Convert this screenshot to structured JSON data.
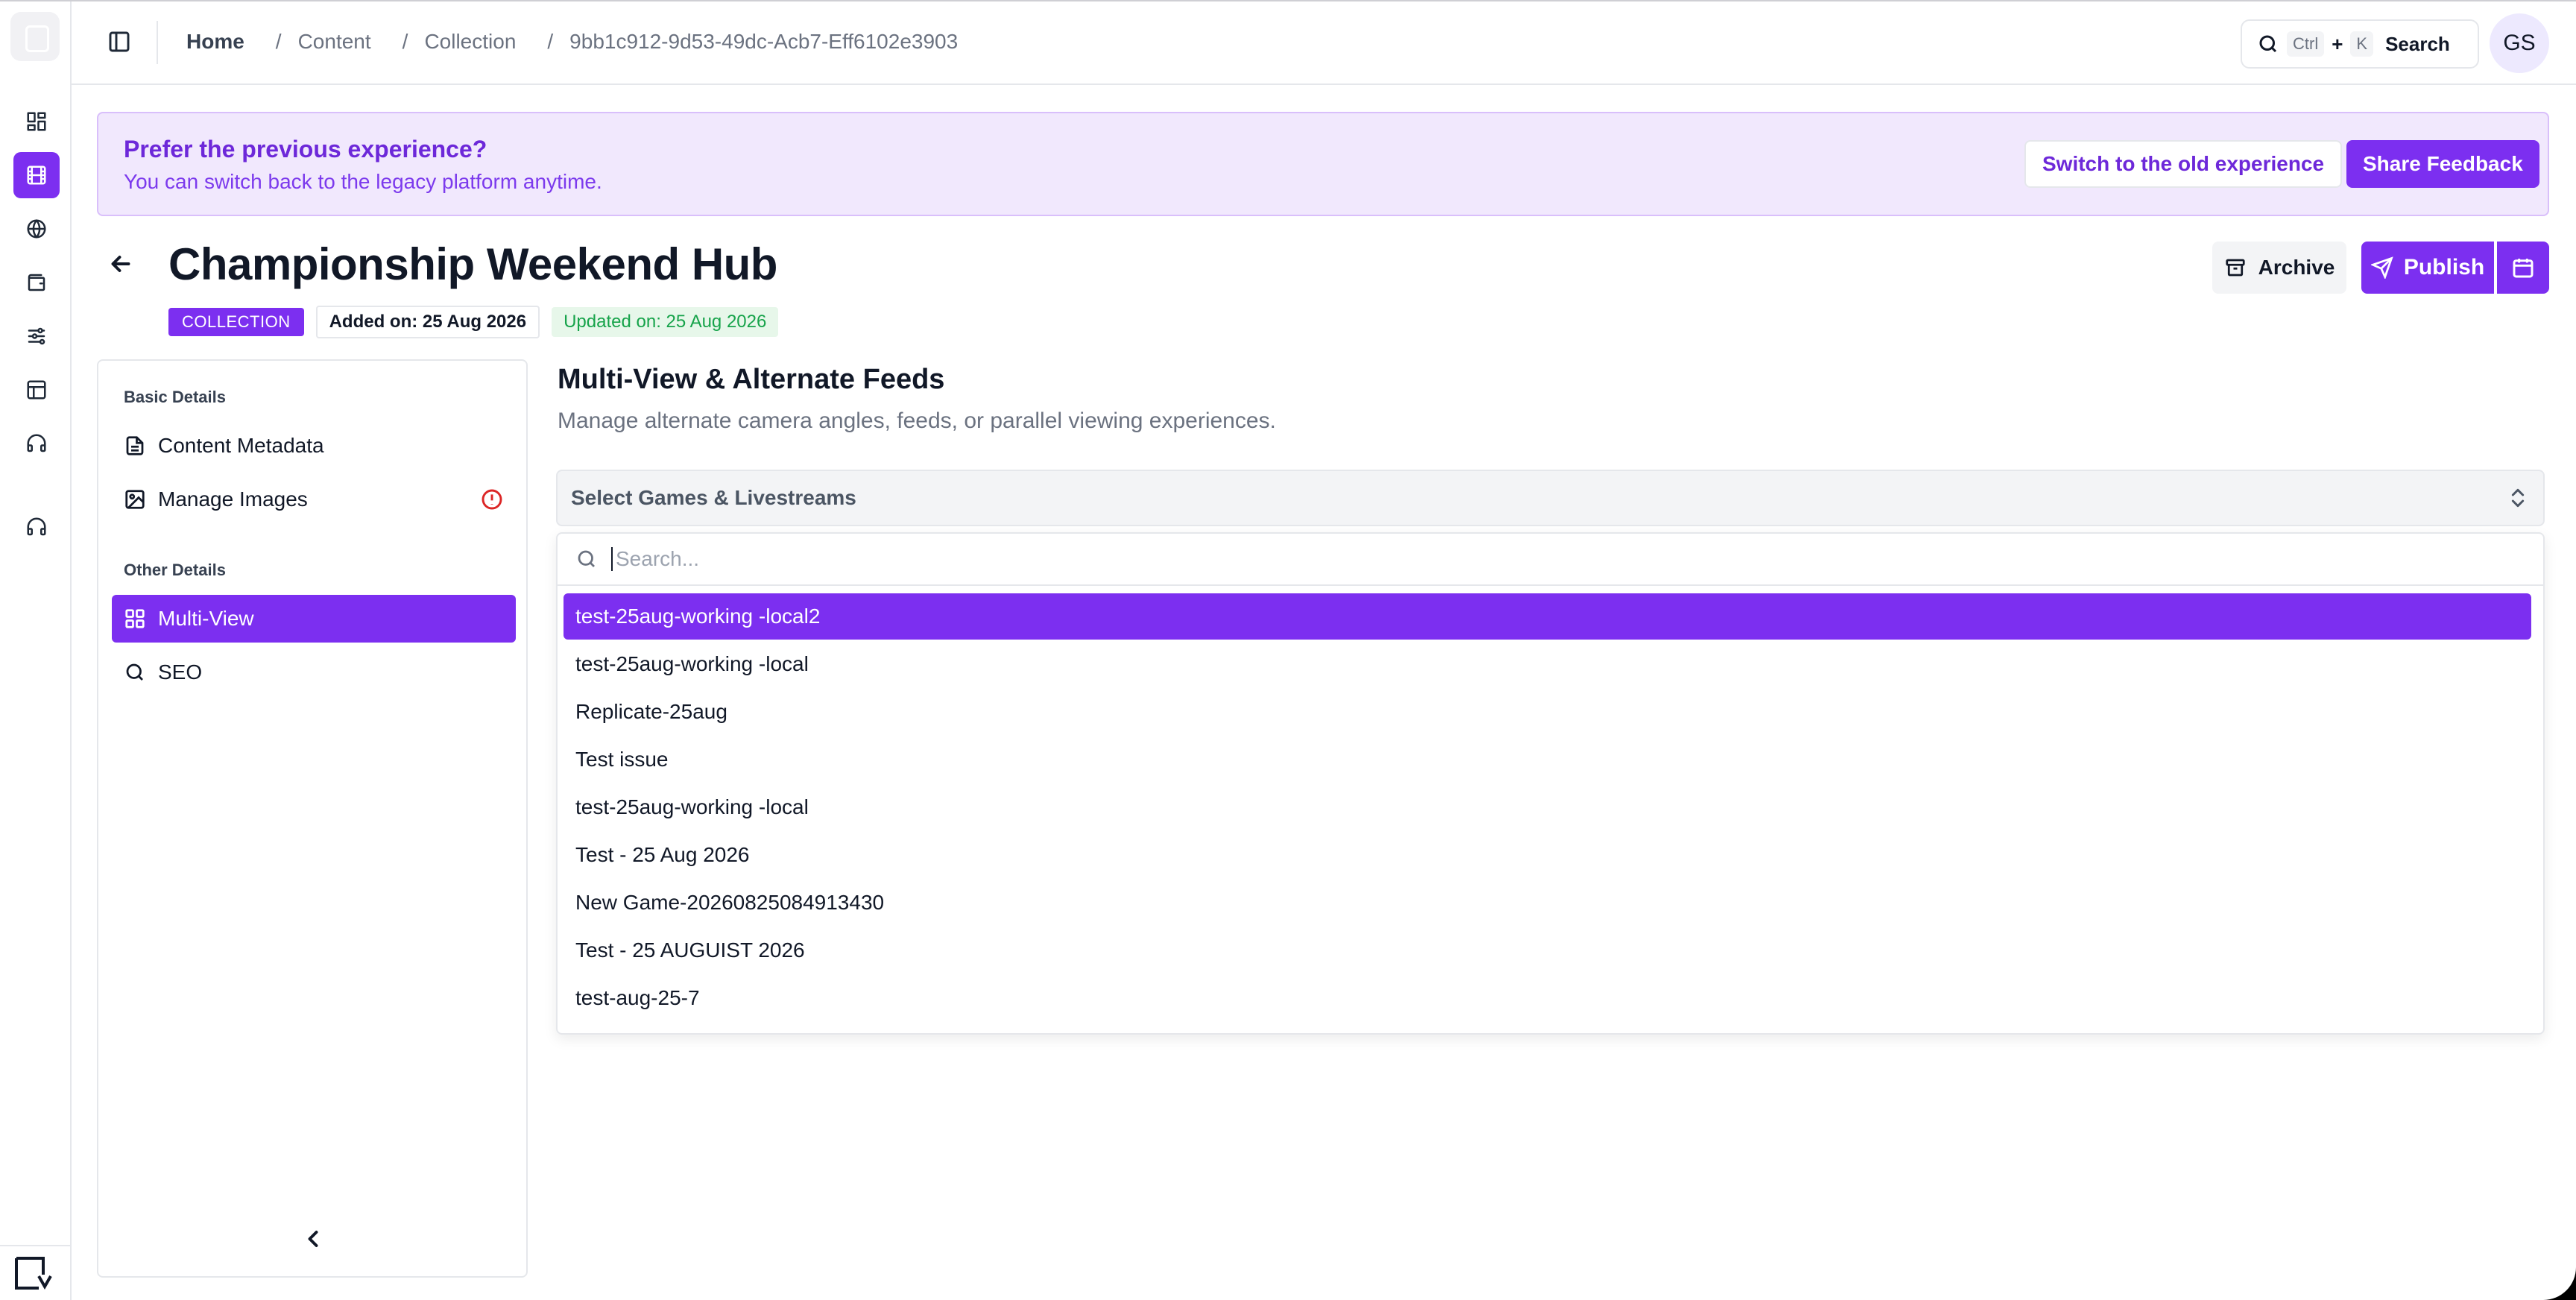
{
  "topbar": {
    "breadcrumb": [
      "Home",
      "Content",
      "Collection",
      "9bb1c912-9d53-49dc-Acb7-Eff6102e3903"
    ],
    "search": {
      "kbd1": "Ctrl",
      "plus": "+",
      "kbd2": "K",
      "label": "Search"
    },
    "avatar_initials": "GS"
  },
  "banner": {
    "title": "Prefer the previous experience?",
    "subtitle": "You can switch back to the legacy platform anytime.",
    "switch_label": "Switch to the old experience",
    "feedback_label": "Share Feedback"
  },
  "page": {
    "title": "Championship Weekend Hub",
    "type_badge": "COLLECTION",
    "added": "Added on: 25 Aug 2026",
    "updated": "Updated on: 25 Aug 2026",
    "archive_label": "Archive",
    "publish_label": "Publish"
  },
  "sidenav": {
    "basic_title": "Basic Details",
    "basic_items": [
      "Content Metadata",
      "Manage Images"
    ],
    "other_title": "Other Details",
    "other_items": [
      "Multi-View",
      "SEO"
    ]
  },
  "main": {
    "title": "Multi-View & Alternate Feeds",
    "description": "Manage alternate camera angles, feeds, or parallel viewing experiences.",
    "select_placeholder": "Select Games & Livestreams",
    "search_placeholder": "Search...",
    "options": [
      "test-25aug-working -local2",
      "test-25aug-working -local",
      "Replicate-25aug",
      "Test issue",
      "test-25aug-working -local",
      "Test - 25 Aug 2026",
      "New Game-20260825084913430",
      "Test - 25 AUGUIST 2026",
      "test-aug-25-7"
    ],
    "active_option_index": 0
  },
  "colors": {
    "accent": "#7c2ff0",
    "banner_bg": "#f1e8fd",
    "updated_green": "#16a34a",
    "warning": "#dc2626"
  }
}
